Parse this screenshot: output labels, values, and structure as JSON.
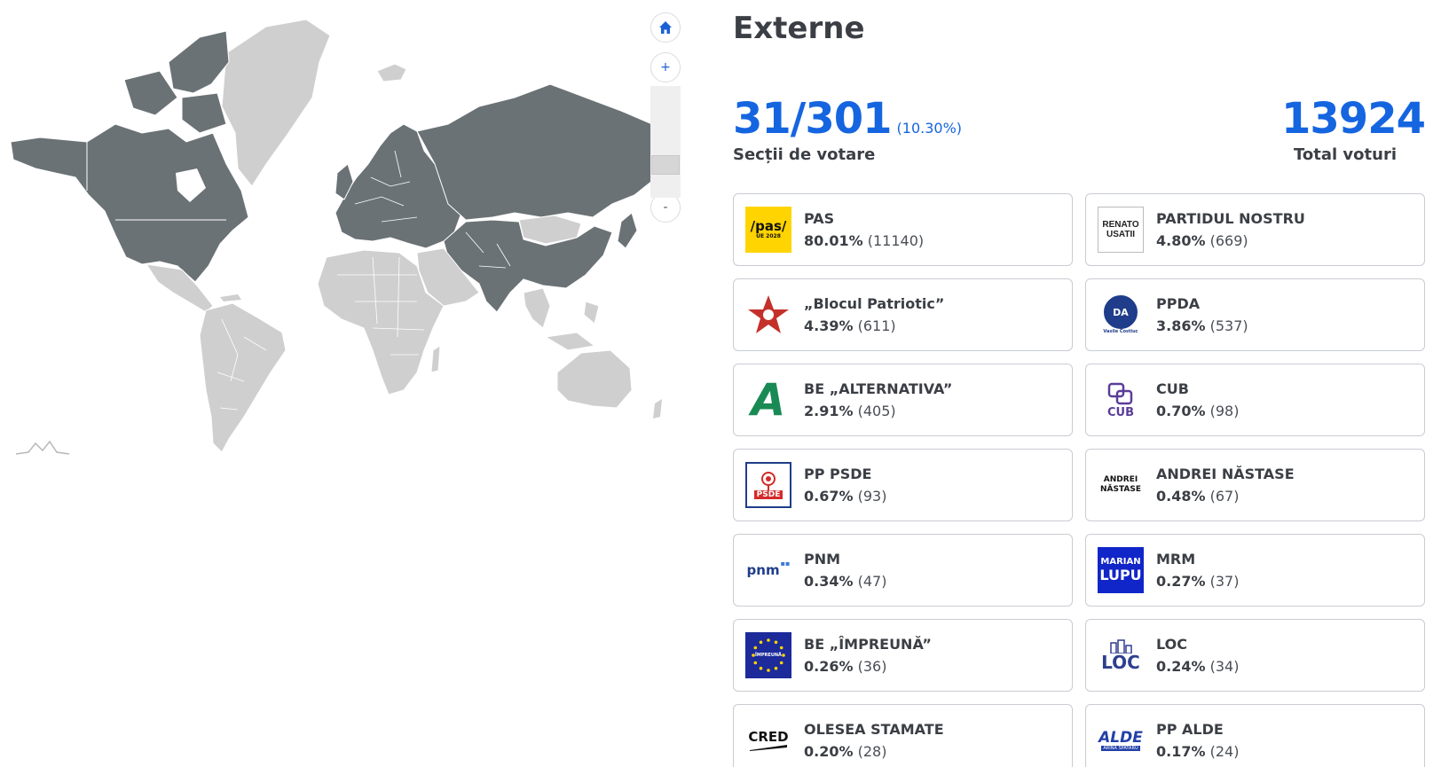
{
  "colors": {
    "accent_blue": "#1565e0",
    "map_reporting": "#6b7275",
    "map_other": "#cfcfcf",
    "text_dark": "#3b3f45",
    "card_border": "#c9ccd2"
  },
  "map": {
    "controls": {
      "home_icon": "home-icon",
      "zoom_in_label": "+",
      "zoom_out_label": "-",
      "zoom_level_fraction": 0.75
    }
  },
  "region": {
    "title": "Externe"
  },
  "stations": {
    "value": "31/301",
    "percent": "(10.30%)",
    "label": "Secții de votare"
  },
  "total": {
    "value": "13924",
    "label": "Total voturi"
  },
  "parties": [
    {
      "name": "PAS",
      "pct": "80.01%",
      "count": "(11140)",
      "logo_icon": "pas-logo-icon",
      "logo_text": "/pas/",
      "logo_sub": "UE 2028"
    },
    {
      "name": "PARTIDUL NOSTRU",
      "pct": "4.80%",
      "count": "(669)",
      "logo_icon": "renato-usatii-logo-icon",
      "logo_text": "RENATO",
      "logo_sub": "USATII"
    },
    {
      "name": "„Blocul Patriotic”",
      "pct": "4.39%",
      "count": "(611)",
      "logo_icon": "red-star-logo-icon"
    },
    {
      "name": "PPDA",
      "pct": "3.86%",
      "count": "(537)",
      "logo_icon": "ppda-seal-logo-icon",
      "logo_text": "DA",
      "logo_sub": "Vasile Costiuc"
    },
    {
      "name": "BE „ALTERNATIVA”",
      "pct": "2.91%",
      "count": "(405)",
      "logo_icon": "alternativa-logo-icon",
      "logo_text": "A"
    },
    {
      "name": "CUB",
      "pct": "0.70%",
      "count": "(98)",
      "logo_icon": "cub-logo-icon",
      "logo_text": "CUB"
    },
    {
      "name": "PP PSDE",
      "pct": "0.67%",
      "count": "(93)",
      "logo_icon": "psde-logo-icon",
      "logo_text": "PSDE"
    },
    {
      "name": "ANDREI NĂSTASE",
      "pct": "0.48%",
      "count": "(67)",
      "logo_icon": "andrei-nastase-logo-icon",
      "logo_text": "ANDREI",
      "logo_sub": "NĂSTASE"
    },
    {
      "name": "PNM",
      "pct": "0.34%",
      "count": "(47)",
      "logo_icon": "pnm-logo-icon",
      "logo_text": "pnm"
    },
    {
      "name": "MRM",
      "pct": "0.27%",
      "count": "(37)",
      "logo_icon": "marian-lupu-logo-icon",
      "logo_text": "MARIAN",
      "logo_sub": "LUPU"
    },
    {
      "name": "BE „ÎMPREUNĂ”",
      "pct": "0.26%",
      "count": "(36)",
      "logo_icon": "eu-stars-logo-icon",
      "logo_text": "ÎMPREUNĂ"
    },
    {
      "name": "LOC",
      "pct": "0.24%",
      "count": "(34)",
      "logo_icon": "loc-logo-icon",
      "logo_text": "LOC"
    },
    {
      "name": "OLESEA STAMATE",
      "pct": "0.20%",
      "count": "(28)",
      "logo_icon": "cred-logo-icon",
      "logo_text": "CRED"
    },
    {
      "name": "PP ALDE",
      "pct": "0.17%",
      "count": "(24)",
      "logo_icon": "alde-logo-icon",
      "logo_text": "ALDE",
      "logo_sub": "ARINA SPATARU"
    }
  ]
}
